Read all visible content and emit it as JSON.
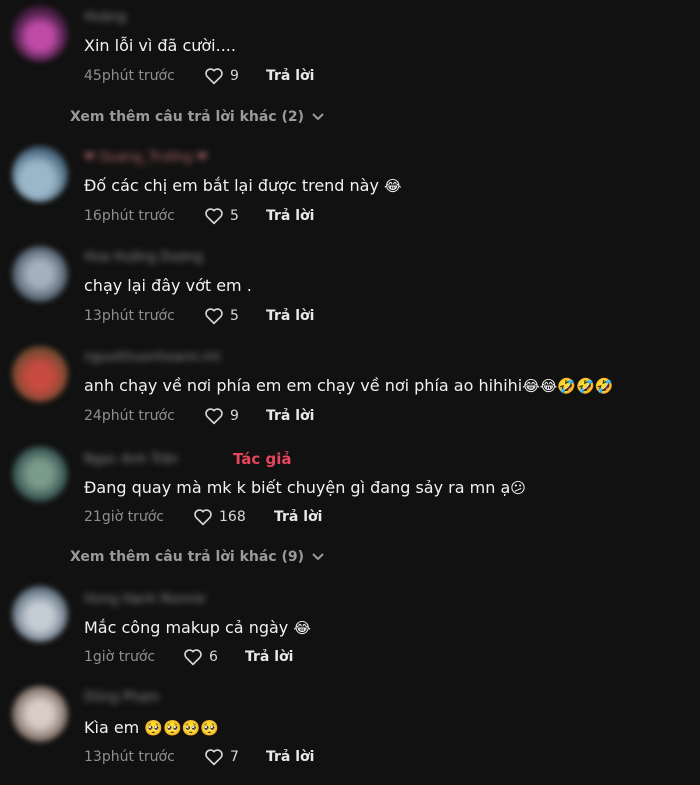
{
  "comments": [
    {
      "username": "Hoàng",
      "text": "Xin lỗi vì đã cười....",
      "emoji": "",
      "time": "45phút trước",
      "likes": "9",
      "reply": "Trả lời",
      "avatar_color": "#7b2f6e"
    },
    {
      "username": "❤ Quang_Trường ❤",
      "text": "Đố các chị em bắt lại được trend này",
      "emoji": "😂",
      "time": "16phút trước",
      "likes": "5",
      "reply": "Trả lời",
      "avatar_color": "#5a7fa0"
    },
    {
      "username": "Hoa Hướng Dương",
      "text": "chạy lại đây vớt em .",
      "emoji": "",
      "time": "13phút trước",
      "likes": "5",
      "reply": "Trả lời",
      "avatar_color": "#6f8094"
    },
    {
      "username": "nguoithuonhoami.mt",
      "text": "anh chạy về nơi phía em em chạy về nơi phía ao hihihi",
      "emoji": "😂😂🤣🤣🤣",
      "time": "24phút trước",
      "likes": "9",
      "reply": "Trả lời",
      "avatar_color": "#8a4a3a"
    },
    {
      "username": "Ngọc Anh Trần",
      "author_badge": "Tác giả",
      "text": "Đang quay mà mk k biết chuyện gì đang sảy ra mn ạ",
      "emoji": "😕",
      "time": "21giờ trước",
      "likes": "168",
      "reply": "Trả lời",
      "avatar_color": "#4d6e6a"
    },
    {
      "username": "Hong Hạnh Ronnie",
      "text": "Mắc công makup cả ngày",
      "emoji": "😂",
      "time": "1giờ trước",
      "likes": "6",
      "reply": "Trả lời",
      "avatar_color": "#7a8a9a"
    },
    {
      "username": "Dũng Phạm",
      "text": "Kìa em",
      "emoji": "🥺🥺🥺🥺",
      "time": "13phút trước",
      "likes": "7",
      "reply": "Trả lời",
      "avatar_color": "#9a8f88"
    }
  ],
  "more_replies": [
    {
      "label": "Xem thêm câu trả lời khác (2)"
    },
    {
      "label": "Xem thêm câu trả lời khác (9)"
    }
  ],
  "colors": {
    "background": "#111111",
    "author_badge": "#e8455e",
    "meta": "#8f8f8f"
  }
}
